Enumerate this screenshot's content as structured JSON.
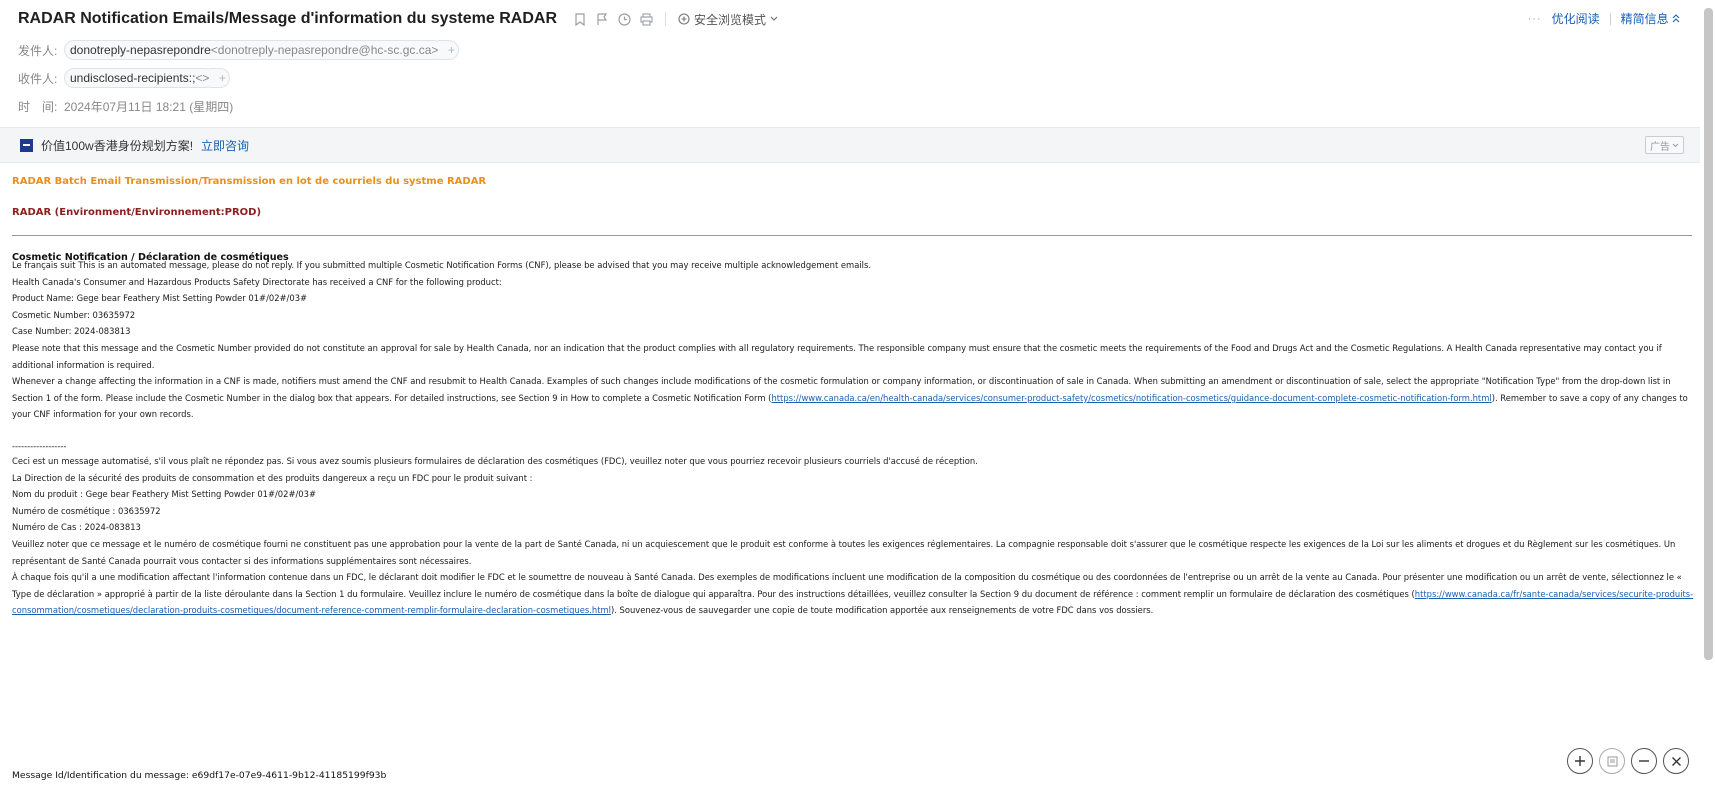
{
  "header": {
    "subject": "RADAR Notification Emails/Message d'information du systeme RADAR",
    "safe_mode_label": "安全浏览模式",
    "more_label": "···",
    "optimize_read": "优化阅读",
    "compact_info": "精简信息"
  },
  "from": {
    "label": "发件人:",
    "name": "donotreply-nepasrepondre",
    "address": "<donotreply-nepasrepondre@hc-sc.gc.ca>"
  },
  "to": {
    "label": "收件人:",
    "name": "undisclosed-recipients:;",
    "address": "<>"
  },
  "time": {
    "label": "时　间:",
    "value": "2024年07月11日 18:21 (星期四)"
  },
  "ad": {
    "text": "价值100w香港身份规划方案!",
    "link": "立即咨询",
    "tag": "广告"
  },
  "body": {
    "batch_title": "RADAR Batch Email Transmission/Transmission en lot de courriels du systme RADAR",
    "env_title": "RADAR (Environment/Environnement:PROD)",
    "section_title": "Cosmetic Notification / Déclaration de cosmétiques",
    "en": {
      "l1": "Le français suit This is an automated message, please do not reply. If you submitted multiple Cosmetic Notification Forms (CNF), please be advised that you may receive multiple acknowledgement emails.",
      "l2": "Health Canada's Consumer and Hazardous Products Safety Directorate has received a CNF for the following product:",
      "l3": "Product Name: Gege bear Feathery Mist Setting Powder 01#/02#/03#",
      "l4": "Cosmetic Number: 03635972",
      "l5": "Case Number: 2024-083813",
      "p1": "Please note that this message and the Cosmetic Number provided do not constitute an approval for sale by Health Canada, nor an indication that the product complies with all regulatory requirements. The responsible company must ensure that the cosmetic meets the requirements of the Food and Drugs Act and the Cosmetic Regulations. A Health Canada representative may contact you if additional information is required.",
      "p2_before": "Whenever a change affecting the information in a CNF is made, notifiers must amend the CNF and resubmit to Health Canada. Examples of such changes include modifications of the cosmetic formulation or company information, or discontinuation of sale in Canada. When submitting an amendment or discontinuation of sale, select the appropriate \"Notification Type\" from the drop-down list in Section 1 of the form. Please include the Cosmetic Number in the dialog box that appears. For detailed instructions, see Section 9 in How to complete a Cosmetic Notification Form (",
      "p2_link": "https://www.canada.ca/en/health-canada/services/consumer-product-safety/cosmetics/notification-cosmetics/guidance-document-complete-cosmetic-notification-form.html",
      "p2_after": "). Remember to save a copy of any changes to your CNF information for your own records."
    },
    "separator": "------------------",
    "fr": {
      "l1": "Ceci est un message automatisé, s'il vous plaît ne répondez pas. Si vous avez soumis plusieurs formulaires de déclaration des cosmétiques (FDC), veuillez noter que vous pourriez recevoir plusieurs courriels d'accusé de réception.",
      "l2": "La Direction de la sécurité des produits de consommation et des produits dangereux a reçu un FDC pour le produit suivant :",
      "l3": "Nom du produit : Gege bear Feathery Mist Setting Powder 01#/02#/03#",
      "l4": "Numéro de cosmétique : 03635972",
      "l5": "Numéro de Cas : 2024-083813",
      "p1": "Veuillez noter que ce message et le numéro de cosmétique fourni ne constituent pas une approbation pour la vente de la part de Santé Canada, ni un acquiescement que le produit est conforme à toutes les exigences réglementaires. La compagnie responsable doit s'assurer que le cosmétique respecte les exigences de la Loi sur les aliments et drogues et du Règlement sur les cosmétiques. Un représentant de Santé Canada pourrait vous contacter si des informations supplémentaires sont nécessaires.",
      "p2_before": "À chaque fois qu'il a une modification affectant l'information contenue dans un FDC, le déclarant doit modifier le FDC et le soumettre de nouveau à Santé Canada. Des exemples de modifications incluent une modification de la composition du cosmétique ou des coordonnées de l'entreprise ou un arrêt de la vente au Canada. Pour présenter une modification ou un arrêt de vente, sélectionnez le « Type de déclaration » approprié à partir de la liste déroulante dans la Section 1 du formulaire. Veuillez inclure le numéro de cosmétique dans la boîte de dialogue qui apparaîtra. Pour des instructions détaillées, veuillez consulter la Section 9 du document de référence : comment remplir un formulaire de déclaration des cosmétiques (",
      "p2_link": "https://www.canada.ca/fr/sante-canada/services/securite-produits-consommation/cosmetiques/declaration-produits-cosmetiques/document-reference-comment-remplir-formulaire-declaration-cosmetiques.html",
      "p2_after": "). Souvenez-vous de sauvegarder une copie de toute modification apportée aux renseignements de votre FDC dans vos dossiers."
    },
    "message_id": "Message Id/Identification du message: e69df17e-07e9-4611-9b12-41185199f93b"
  }
}
